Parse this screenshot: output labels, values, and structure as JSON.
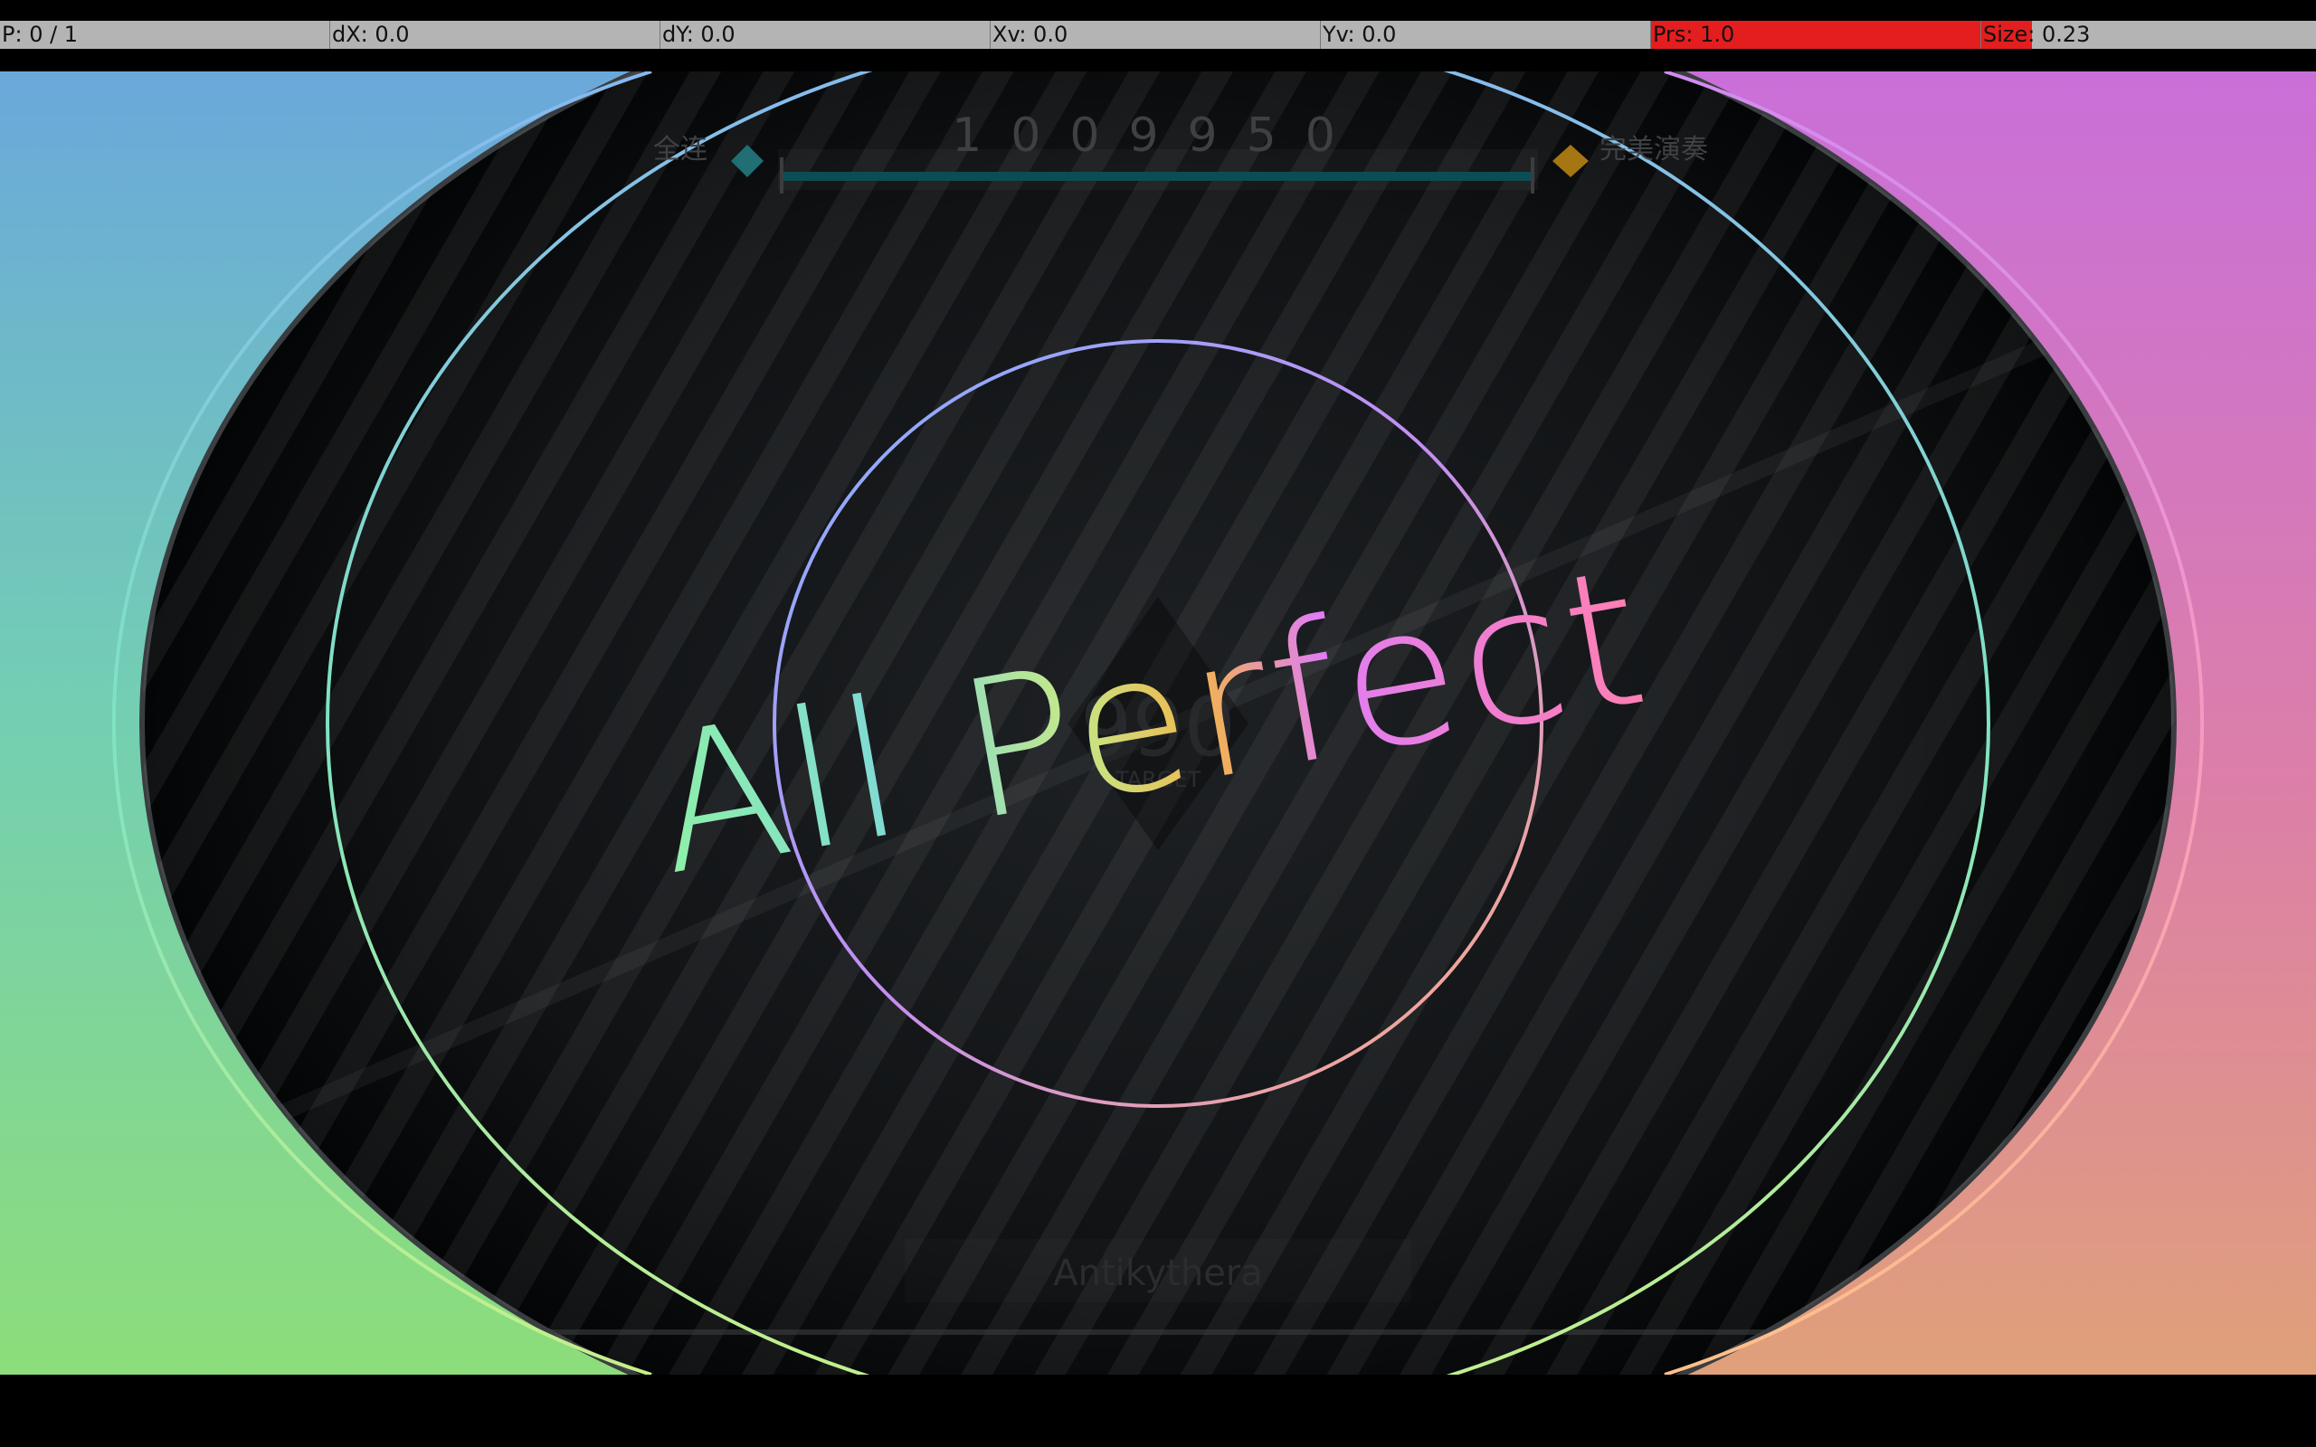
{
  "debug": {
    "p": "P: 0 / 1",
    "dx": "dX: 0.0",
    "dy": "dY: 0.0",
    "xv": "Xv: 0.0",
    "yv": "Yv: 0.0",
    "prs": "Prs: 1.0",
    "prs_level": 1.0,
    "size": "Size: 0.23",
    "size_level": 0.15,
    "fill_color": "#e41e1e"
  },
  "hud": {
    "score": "1009950",
    "full_combo_label": "全连",
    "all_perfect_label": "完美演奏",
    "progress": 1.0,
    "bar_color": "#0c4d55",
    "left_gem_color": "#1f6f74",
    "right_gem_color": "#a67613"
  },
  "result": {
    "text": "All Perfect",
    "song_title": "Antikythera"
  },
  "palette": {
    "left_top": "#6aa8db",
    "left_bottom": "#8ddd7a",
    "right_top": "#c96fd8",
    "right_bottom": "#e0a07a"
  }
}
